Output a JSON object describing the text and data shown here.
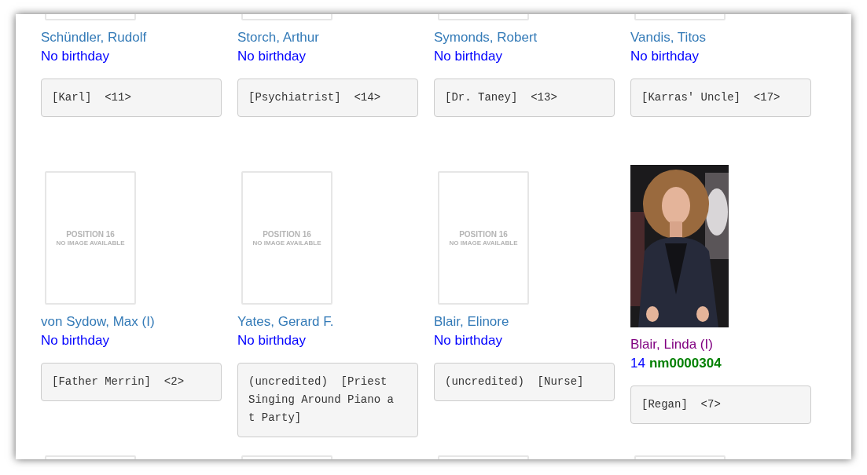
{
  "cast": [
    {
      "image": {
        "kind": "placeholder"
      },
      "name": "Schündler, Rudolf",
      "visited": false,
      "birthday": "No birthday",
      "role": "[Karl]  <11>"
    },
    {
      "image": {
        "kind": "placeholder"
      },
      "name": "Storch, Arthur",
      "visited": false,
      "birthday": "No birthday",
      "role": "[Psychiatrist]  <14>"
    },
    {
      "image": {
        "kind": "placeholder"
      },
      "name": "Symonds, Robert",
      "visited": false,
      "birthday": "No birthday",
      "role": "[Dr. Taney]  <13>"
    },
    {
      "image": {
        "kind": "placeholder"
      },
      "name": "Vandis, Titos",
      "visited": false,
      "birthday": "No birthday",
      "role": "[Karras' Uncle]  <17>"
    },
    {
      "image": {
        "kind": "placeholder",
        "lines": [
          "POSITION 16",
          "NO IMAGE AVAILABLE"
        ]
      },
      "name": "von Sydow, Max (I)",
      "visited": false,
      "birthday": "No birthday",
      "role": "[Father Merrin]  <2>"
    },
    {
      "image": {
        "kind": "placeholder",
        "lines": [
          "POSITION 16",
          "NO IMAGE AVAILABLE"
        ]
      },
      "name": "Yates, Gerard F.",
      "visited": false,
      "birthday": "No birthday",
      "role": "(uncredited)  [Priest Singing Around Piano at Party]"
    },
    {
      "image": {
        "kind": "placeholder",
        "lines": [
          "POSITION 16",
          "NO IMAGE AVAILABLE"
        ]
      },
      "name": "Blair, Elinore",
      "visited": false,
      "birthday": "No birthday",
      "role": "(uncredited)  [Nurse]"
    },
    {
      "name": "Blair, Linda (I)",
      "visited": true,
      "rank": "14",
      "id": "nm0000304",
      "role": "[Regan]  <7>"
    },
    {
      "image": {
        "kind": "placeholder"
      }
    },
    {
      "image": {
        "kind": "placeholder"
      }
    },
    {
      "image": {
        "kind": "placeholder"
      }
    },
    {
      "image": {
        "kind": "placeholder"
      }
    }
  ]
}
